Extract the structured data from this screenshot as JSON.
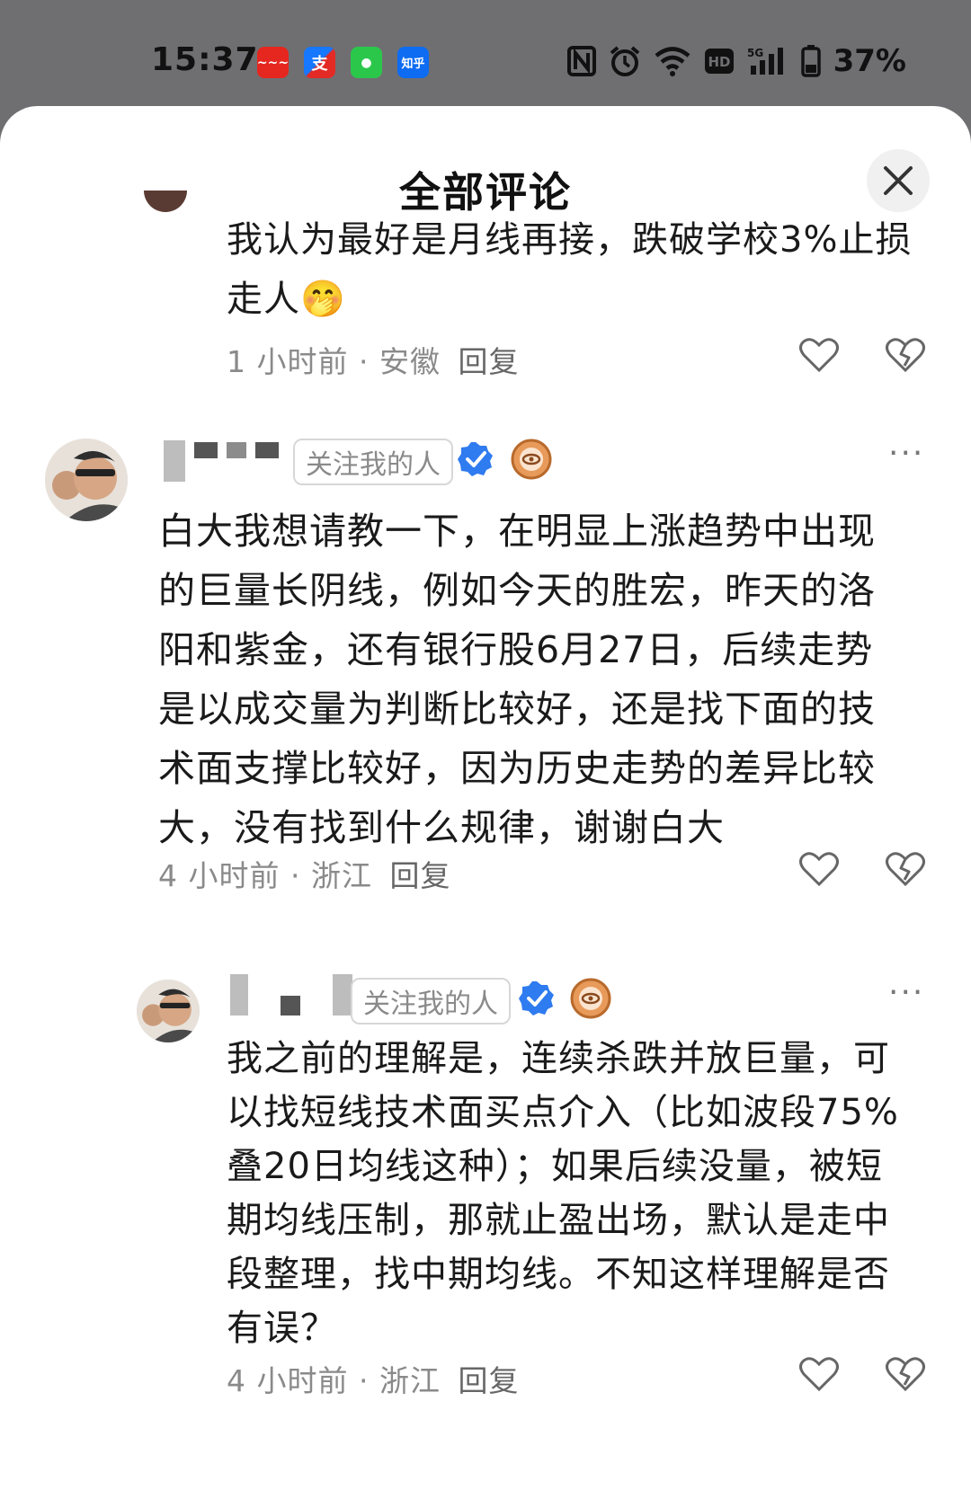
{
  "status_bar": {
    "time": "15:37",
    "apps": [
      {
        "name": "app-icon-1",
        "glyph": "~~~"
      },
      {
        "name": "alipay-icon",
        "glyph": "支"
      },
      {
        "name": "messages-icon",
        "glyph": "●"
      },
      {
        "name": "zhihu-icon",
        "glyph": "知乎"
      }
    ],
    "network": "5G",
    "hd": "HD",
    "battery": "37%"
  },
  "sheet": {
    "title": "全部评论"
  },
  "comments": [
    {
      "text_lines": [
        "我认为最好是月线再接，跌破学校3%止损",
        "走人🤭"
      ],
      "time": "1 小时前 · 安徽",
      "reply": "回复"
    },
    {
      "tag": "关注我的人",
      "text_lines": [
        "白大我想请教一下，在明显上涨趋势中出现",
        "的巨量长阴线，例如今天的胜宏，昨天的洛",
        "阳和紫金，还有银行股6月27日，后续走势",
        "是以成交量为判断比较好，还是找下面的技",
        "术面支撑比较好，因为历史走势的差异比较",
        "大，没有找到什么规律，谢谢白大"
      ],
      "time": "4 小时前 · 浙江",
      "reply": "回复",
      "more": "···"
    },
    {
      "tag": "关注我的人",
      "text_lines": [
        "我之前的理解是，连续杀跌并放巨量，可",
        "以找短线技术面买点介入（比如波段75%",
        "叠20日均线这种）；如果后续没量，被短",
        "期均线压制，那就止盈出场，默认是走中",
        "段整理，找中期均线。不知这样理解是否",
        "有误？"
      ],
      "time": "4 小时前 · 浙江",
      "reply": "回复",
      "more": "···"
    }
  ]
}
